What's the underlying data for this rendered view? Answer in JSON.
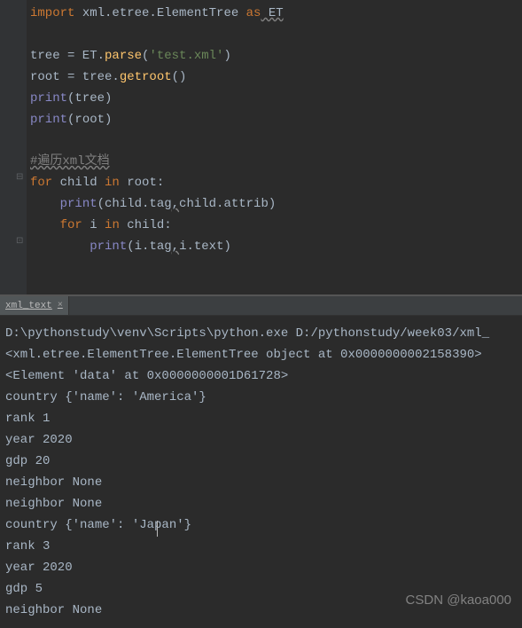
{
  "editor": {
    "lines": {
      "l1_import": "import",
      "l1_module": " xml.etree.ElementTree ",
      "l1_as": "as",
      "l1_alias": " ET",
      "l2": "",
      "l3a": "tree = ET.",
      "l3b": "parse",
      "l3c": "(",
      "l3d": "'test.xml'",
      "l3e": ")",
      "l4a": "root = tree.",
      "l4b": "getroot",
      "l4c": "()",
      "l5a": "print",
      "l5b": "(tree)",
      "l6a": "print",
      "l6b": "(root)",
      "l7": "",
      "l8_comment": "#遍历xml文档",
      "l9_for": "for",
      "l9_mid": " child ",
      "l9_in": "in",
      "l9_end": " root:",
      "l10a": "    ",
      "l10b": "print",
      "l10c": "(child.tag",
      "l10d": ",",
      "l10e": "child.attrib)",
      "l11a": "    ",
      "l11_for": "for",
      "l11_mid": " i ",
      "l11_in": "in",
      "l11_end": " child:",
      "l12a": "        ",
      "l12b": "print",
      "l12c": "(i.tag",
      "l12d": ",",
      "l12e": "i.text)"
    }
  },
  "tab": {
    "label": "xml_text",
    "close": "×"
  },
  "console": {
    "l1": "D:\\pythonstudy\\venv\\Scripts\\python.exe D:/pythonstudy/week03/xml_",
    "l2": "<xml.etree.ElementTree.ElementTree object at 0x0000000002158390>",
    "l3": "<Element 'data' at 0x0000000001D61728>",
    "l4": "country {'name': 'America'}",
    "l5": "rank 1",
    "l6": "year 2020",
    "l7": "gdp 20",
    "l8": "neighbor None",
    "l9": "neighbor None",
    "l10": "country {'name': 'Japan'}",
    "l11": "rank 3",
    "l12": "year 2020",
    "l13": "gdp 5",
    "l14": "neighbor None"
  },
  "watermark": "CSDN @kaoa000"
}
